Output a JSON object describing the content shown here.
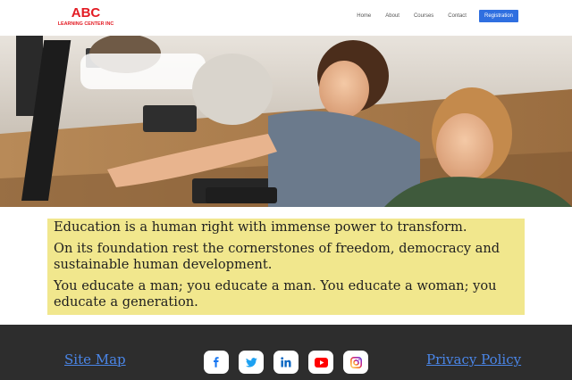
{
  "header": {
    "logo_main": "ABC",
    "logo_sub": "LEARNING CENTER INC",
    "nav": [
      "Home",
      "About",
      "Courses",
      "Contact"
    ],
    "cta": "Registration",
    "brand_color": "#e31b23",
    "cta_color": "#2f6fe0"
  },
  "hero": {
    "image": "classroom-photo"
  },
  "quote": {
    "line1": "Education is a human right with immense power to transform.",
    "line2": "On its foundation rest the cornerstones of freedom, democracy and sustainable human development.",
    "line3": "You educate a man; you educate a man. You educate a woman; you educate a generation.",
    "background": "#f1e78d"
  },
  "footer": {
    "sitemap": "Site Map",
    "privacy": "Privacy Policy",
    "socials": [
      "facebook-icon",
      "twitter-icon",
      "linkedin-icon",
      "youtube-icon",
      "instagram-icon"
    ],
    "background": "#2d2d2d",
    "link_color": "#4a86e8"
  }
}
